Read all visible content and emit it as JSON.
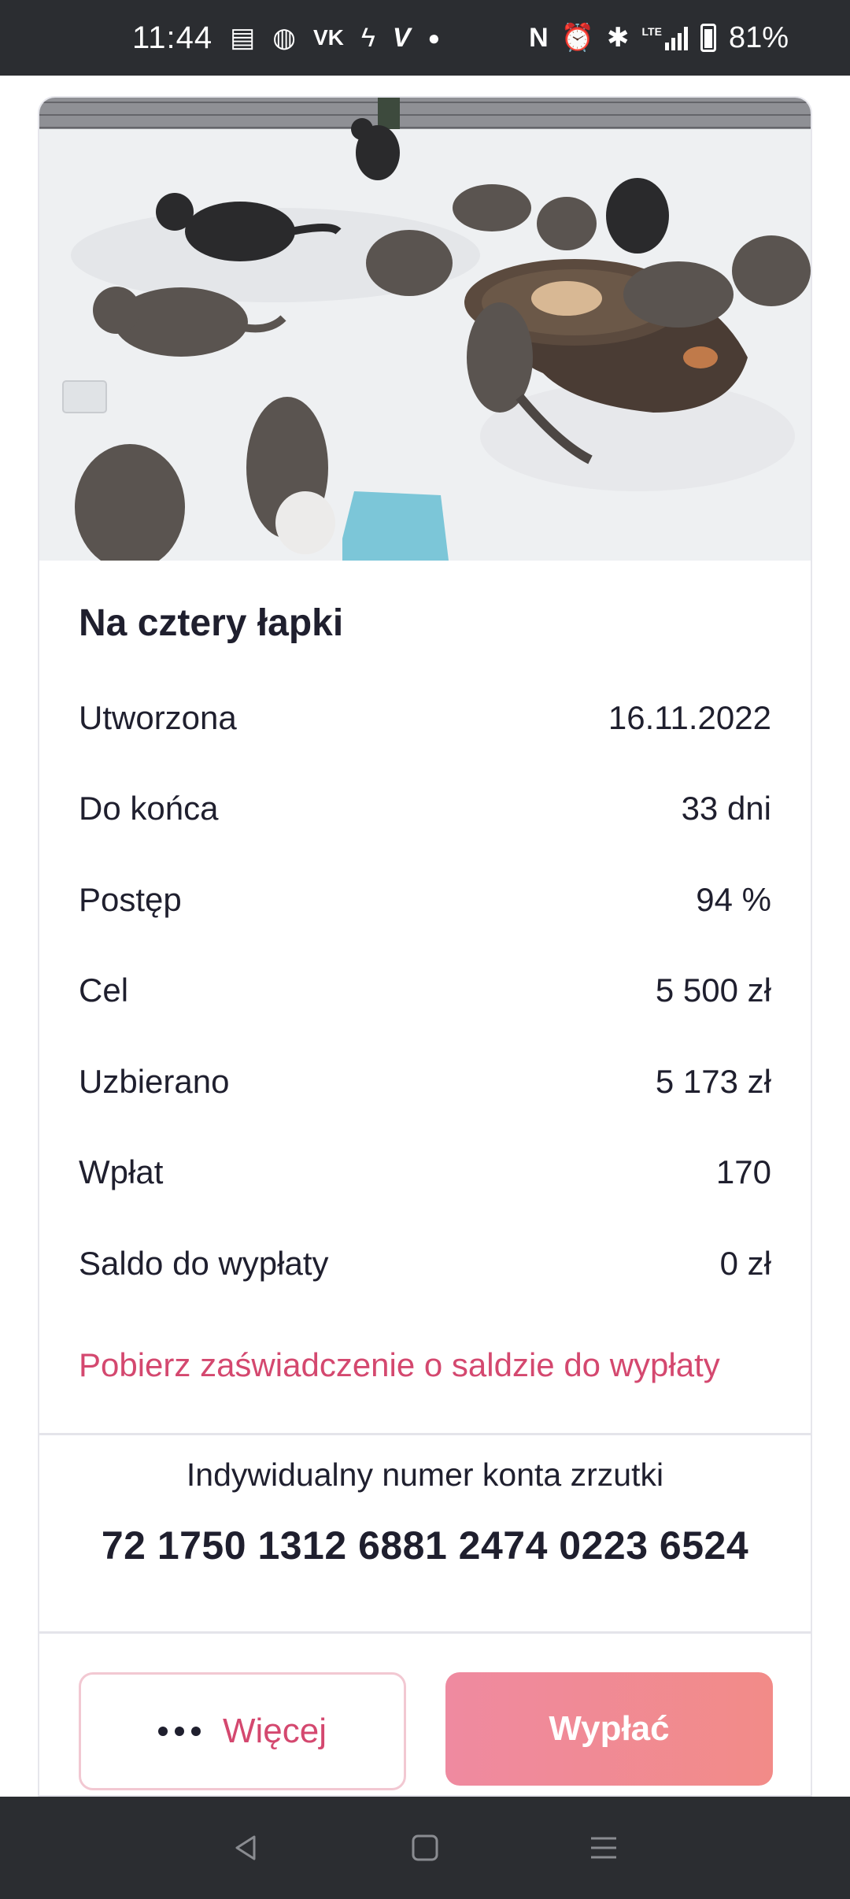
{
  "status_bar": {
    "time": "11:44",
    "battery": "81%",
    "lte_label": "LTE",
    "left_icons": [
      "message-icon",
      "messenger-icon",
      "vk-icon",
      "app-icon",
      "v-icon",
      "dot-icon"
    ],
    "right_icons": [
      "nfc-icon",
      "alarm-icon",
      "bluetooth-icon",
      "signal-icon",
      "battery-icon"
    ]
  },
  "fundraiser": {
    "title": "Na cztery łapki",
    "details": [
      {
        "label": "Utworzona",
        "value": "16.11.2022"
      },
      {
        "label": "Do końca",
        "value": "33 dni"
      },
      {
        "label": "Postęp",
        "value": "94 %"
      },
      {
        "label": "Cel",
        "value": "5 500 zł"
      },
      {
        "label": "Uzbierano",
        "value": "5 173 zł"
      },
      {
        "label": "Wpłat",
        "value": "170"
      },
      {
        "label": "Saldo do wypłaty",
        "value": "0 zł"
      }
    ],
    "certificate_link": "Pobierz zaświadczenie o saldzie do wypłaty",
    "account_label": "Indywidualny numer konta zrzutki",
    "account_number": "72 1750 1312 6881 2474 0223 6524",
    "more_button": "Więcej",
    "withdraw_button": "Wypłać"
  },
  "colors": {
    "accent": "#d4486f",
    "button_gradient_start": "#ef8aa0",
    "button_gradient_end": "#f28b88",
    "system_bar": "#2b2d31"
  },
  "nav_bar": {
    "icons": [
      "back-icon",
      "home-icon",
      "recents-icon"
    ]
  }
}
